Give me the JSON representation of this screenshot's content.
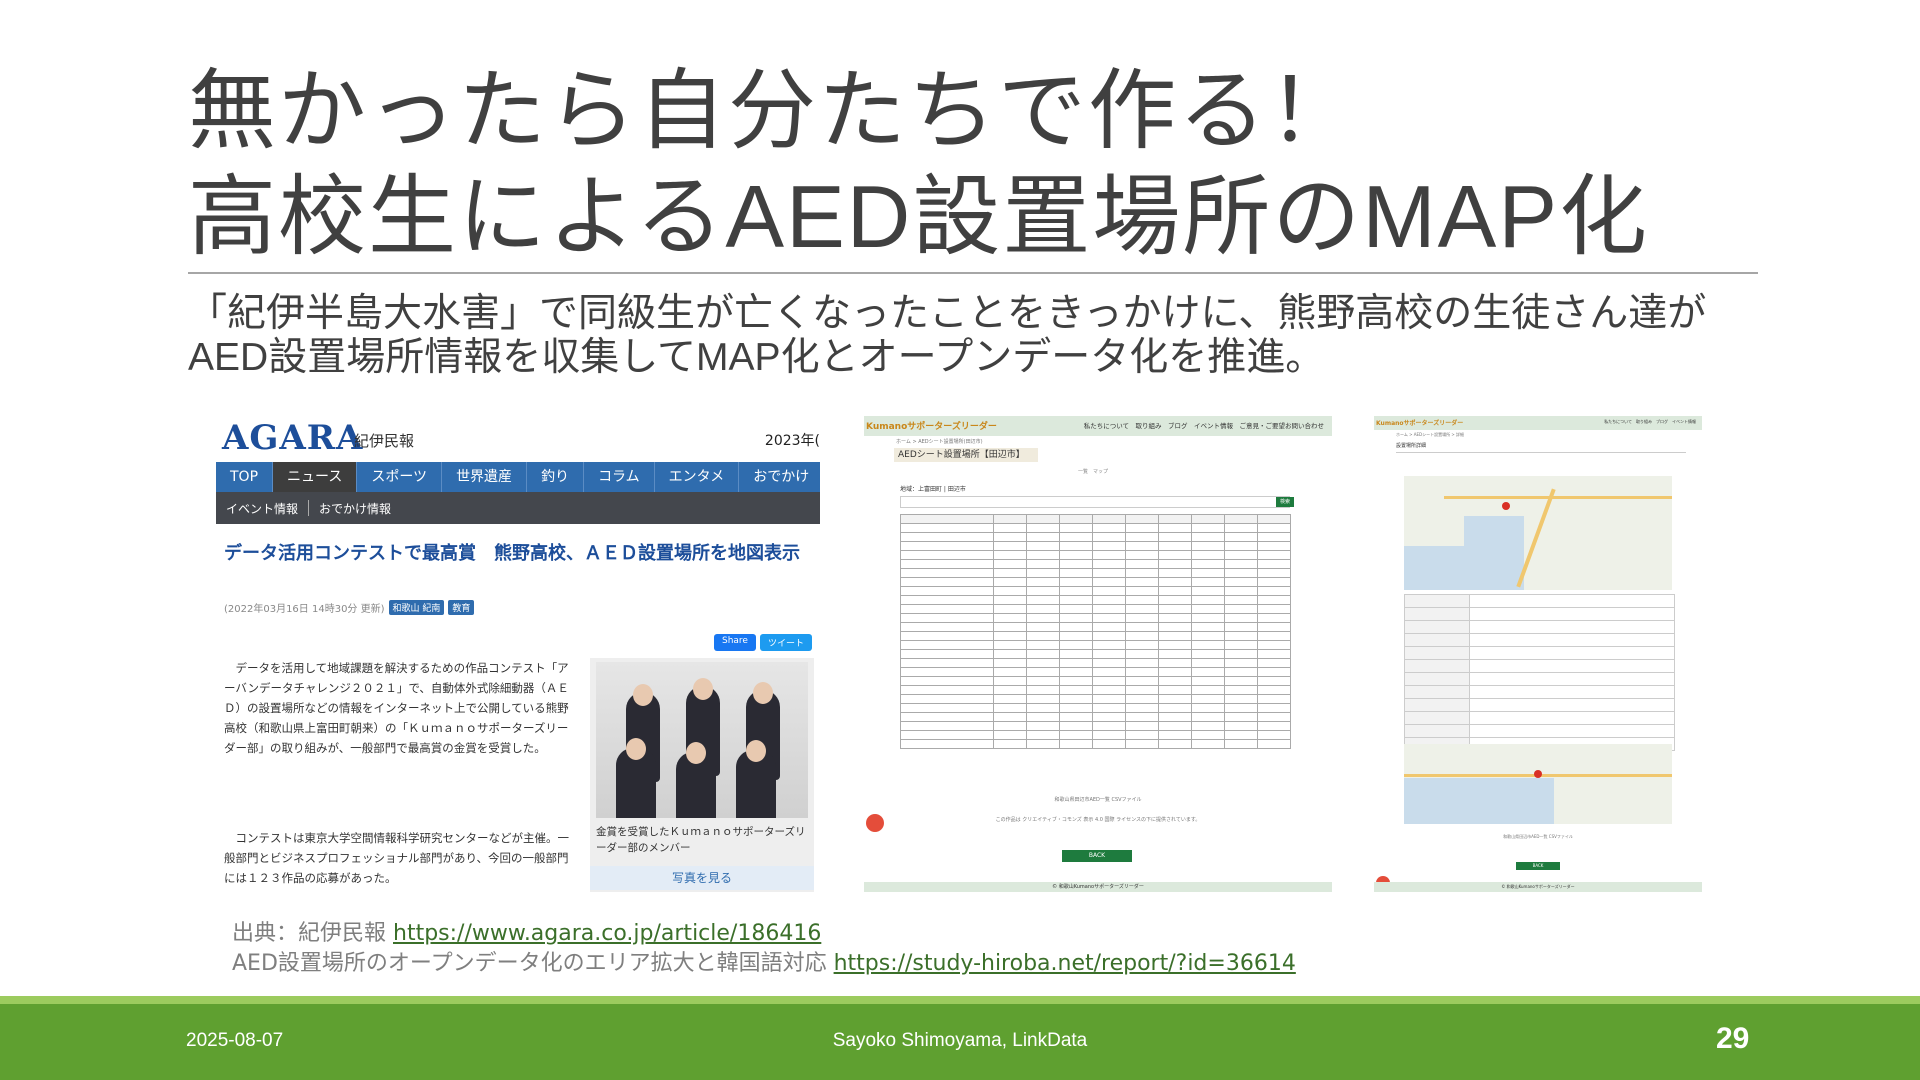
{
  "slide": {
    "title_line1": "無かったら自分たちで作る！",
    "title_line2_prefix": "高校生による",
    "title_line2_aed": "AED",
    "title_line2_mid": "設置場所の",
    "title_line2_map": "MAP",
    "title_line2_suffix": "化",
    "body_line1": "「紀伊半島大水害」で同級生が亡くなったことをきっかけに、熊野高校の生徒さん達が",
    "body_line2_aed": "AED",
    "body_line2_mid": "設置場所情報を収集して",
    "body_line2_map": "MAP",
    "body_line2_suffix": "化とオープンデータ化を推進。"
  },
  "article": {
    "logo": "AGARA",
    "logo_sub": "紀伊民報",
    "date_fragment": "2023年(",
    "nav": [
      "TOP",
      "ニュース",
      "スポーツ",
      "世界遺産",
      "釣り",
      "コラム",
      "エンタメ",
      "おでかけ"
    ],
    "subnav": [
      "イベント情報",
      "おでかけ情報"
    ],
    "headline": "データ活用コンテストで最高賞　熊野高校、ＡＥＤ設置場所を地図表示",
    "byline": "(2022年03月16日 14時30分 更新)",
    "tags": [
      "和歌山 紀南",
      "教育"
    ],
    "share_fb": "Share",
    "share_tw": "ツイート",
    "paragraph1": "データを活用して地域課題を解決するための作品コンテスト「アーバンデータチャレンジ２０２１」で、自動体外式除細動器（ＡＥＤ）の設置場所などの情報をインターネット上で公開している熊野高校（和歌山県上富田町朝来）の「Ｋｕｍａｎｏサポーターズリーダー部」の取り組みが、一般部門で最高賞の金賞を受賞した。",
    "paragraph2": "コンテストは東京大学空間情報科学研究センターなどが主催。一般部門とビジネスプロフェッショナル部門があり、今回の一般部門には１２３作品の応募があった。",
    "photo_caption": "金賞を受賞したＫｕｍａｎｏサポーターズリーダー部のメンバー",
    "photo_link": "写真を見る"
  },
  "aed_site": {
    "brand": "Kumanoサポーターズリーダー",
    "menu": "私たちについて　取り組み　ブログ　イベント情報　ご意見・ご要望お問い合わせ",
    "crumb": "ホーム > AEDシート設置場所(田辺市)",
    "page_title": "AEDシート設置場所【田辺市】",
    "tabs": "一覧　マップ",
    "filter": "地域：上富田町 | 田辺市",
    "search_button": "検索",
    "note": "和歌山県田辺市AED一覧 CSVファイル",
    "license": "この作品は クリエイティブ・コモンズ 表示 4.0 国際 ライセンスの下に提供されています。",
    "back": "BACK",
    "footer": "© 和歌山Kumanoサポーターズリーダー"
  },
  "aed_detail": {
    "brand": "Kumanoサポーターズリーダー",
    "menu": "私たちについて　取り組み　ブログ　イベント情報",
    "crumb": "ホーム > AEDシート設置場所 > 詳細",
    "section": "設置場所詳細",
    "note": "和歌山県田辺市AED一覧 CSVファイル",
    "back": "BACK",
    "footer": "© 和歌山Kumanoサポーターズリーダー"
  },
  "sources": {
    "line1_prefix": "出典：紀伊民報 ",
    "line1_url": "https://www.agara.co.jp/article/186416",
    "line2_prefix": "AED設置場所のオープンデータ化のエリア拡大と韓国語対応 ",
    "line2_url": "https://study-hiroba.net/report/?id=36614"
  },
  "footer": {
    "date": "2025-08-07",
    "author": "Sayoko Shimoyama, LinkData",
    "page": "29"
  },
  "colors": {
    "footer_green": "#5fa030",
    "footer_stripe": "#9ccb5e",
    "link_green": "#3b6f2a",
    "agara_blue": "#1d4e9a"
  }
}
